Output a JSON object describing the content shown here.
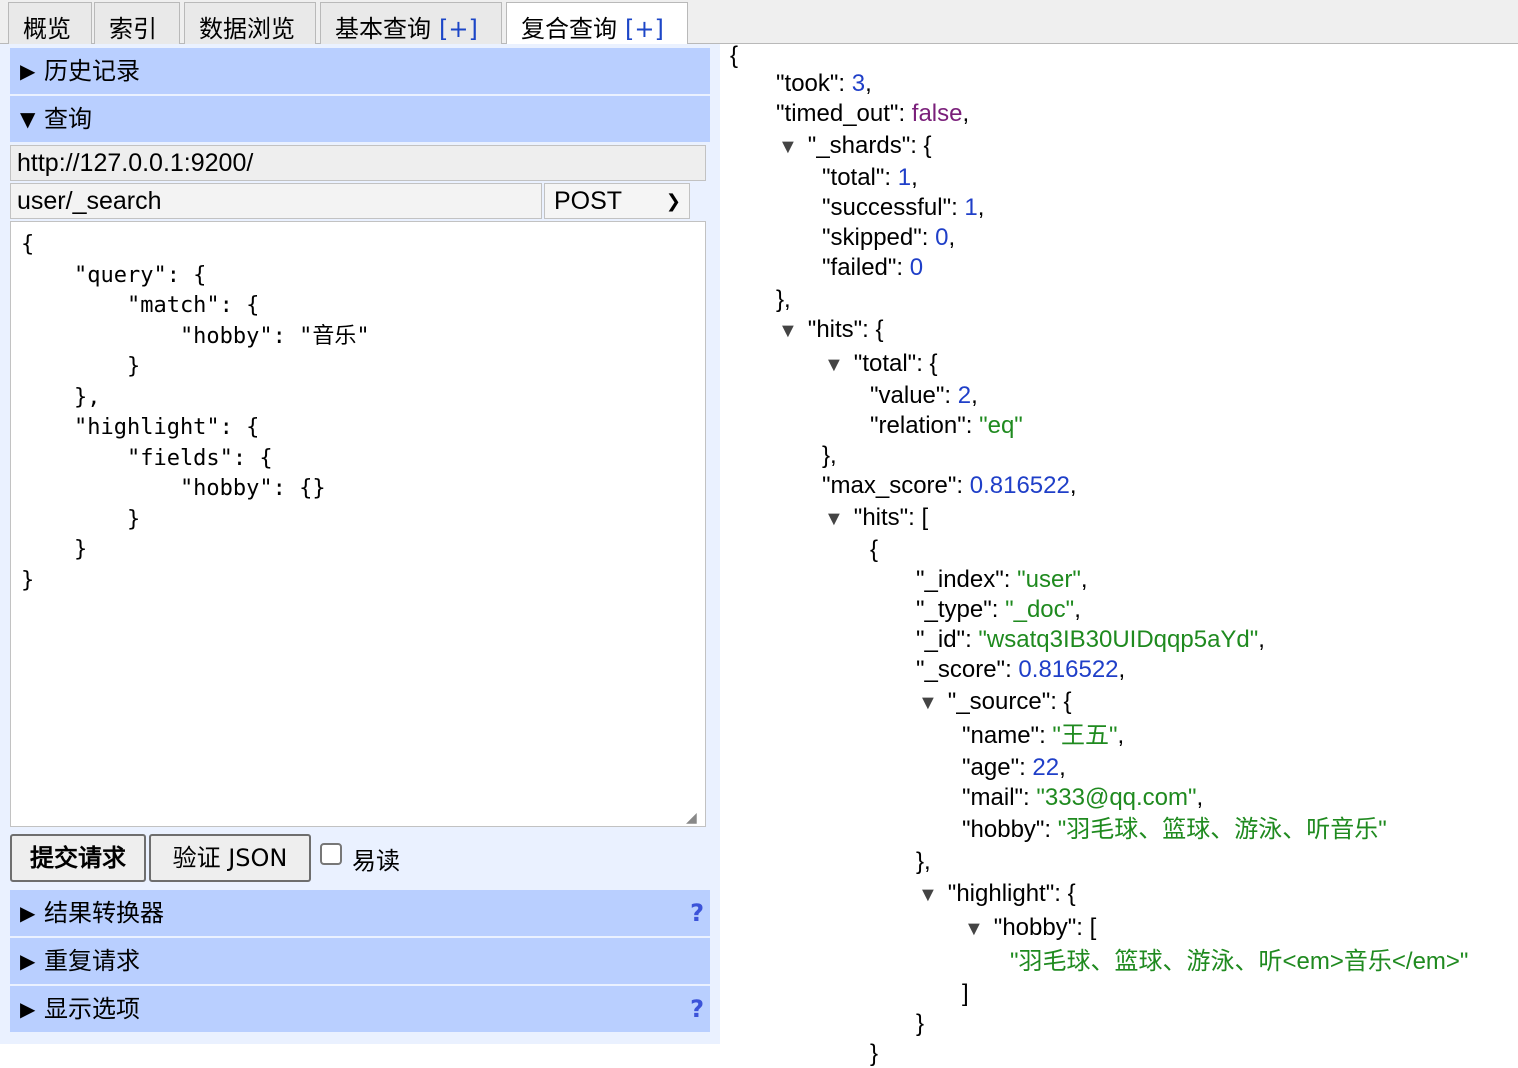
{
  "tabs": [
    {
      "label": "概览"
    },
    {
      "label": "索引"
    },
    {
      "label": "数据浏览"
    },
    {
      "label": "基本查询",
      "plus": "[+]"
    },
    {
      "label": "复合查询",
      "plus": "[+]"
    }
  ],
  "sections": {
    "history": "历史记录",
    "query": "查询",
    "transformer": "结果转换器",
    "repeat": "重复请求",
    "display": "显示选项",
    "help": "?"
  },
  "request": {
    "url": "http://127.0.0.1:9200/",
    "path": "user/_search",
    "method": "POST",
    "body": "{\n    \"query\": {\n        \"match\": {\n            \"hobby\": \"音乐\"\n        }\n    },\n    \"highlight\": {\n        \"fields\": {\n            \"hobby\": {}\n        }\n    }\n}"
  },
  "buttons": {
    "submit": "提交请求",
    "validate": "验证 JSON",
    "readable": "易读"
  },
  "response": {
    "took": "3",
    "timed_out": "false",
    "shards_total": "1",
    "shards_successful": "1",
    "shards_skipped": "0",
    "shards_failed": "0",
    "hits_total_value": "2",
    "hits_total_relation": "\"eq\"",
    "max_score": "0.816522",
    "index": "\"user\"",
    "type": "\"_doc\"",
    "id": "\"wsatq3IB30UIDqqp5aYd\"",
    "score": "0.816522",
    "name": "\"王五\"",
    "age": "22",
    "mail": "\"333@qq.com\"",
    "hobby": "\"羽毛球、篮球、游泳、听音乐\"",
    "highlight_hobby": "\"羽毛球、篮球、游泳、听<em>音乐</em>\""
  }
}
